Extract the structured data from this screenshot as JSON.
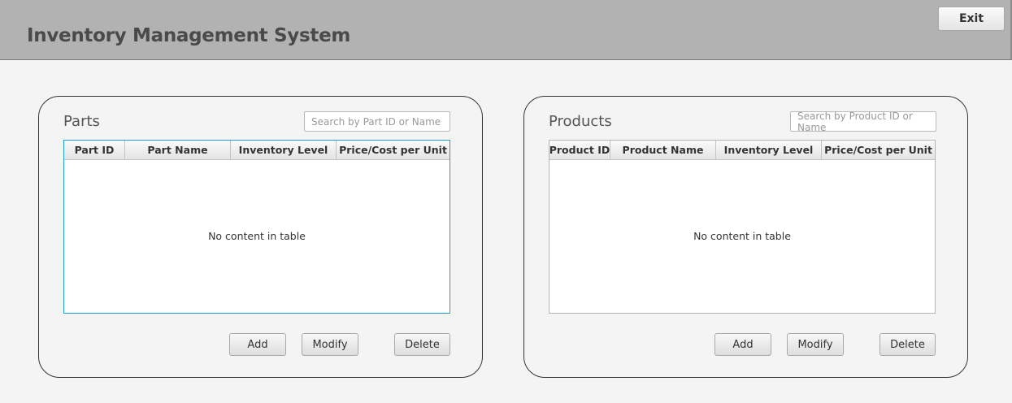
{
  "app": {
    "title": "Inventory Management System",
    "exit_label": "Exit"
  },
  "parts": {
    "title": "Parts",
    "search_placeholder": "Search by Part ID or Name",
    "columns": [
      "Part ID",
      "Part Name",
      "Inventory Level",
      "Price/Cost per Unit"
    ],
    "empty_text": "No content in table",
    "buttons": {
      "add": "Add",
      "modify": "Modify",
      "delete": "Delete"
    }
  },
  "products": {
    "title": "Products",
    "search_placeholder": "Search by Product ID or Name",
    "columns": [
      "Product ID",
      "Product Name",
      "Inventory Level",
      "Price/Cost per Unit"
    ],
    "empty_text": "No content in table",
    "buttons": {
      "add": "Add",
      "modify": "Modify",
      "delete": "Delete"
    }
  },
  "colors": {
    "header_bg": "#b2b2b2",
    "focus_border": "#1f9fcf"
  }
}
